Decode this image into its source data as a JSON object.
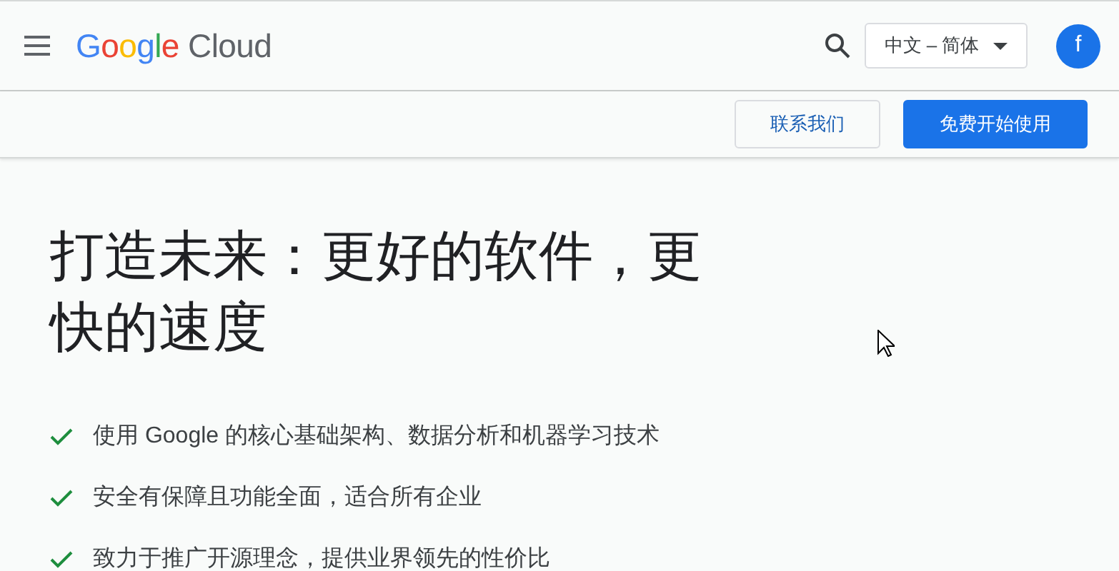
{
  "header": {
    "logo": "Google Cloud",
    "language": "中文 – 简体",
    "avatar": "f"
  },
  "actions": [
    {
      "label": "联系我们",
      "kind": "secondary"
    },
    {
      "label": "免费开始使用",
      "kind": "primary"
    }
  ],
  "hero": {
    "title": "打造未来：更好的软件，更快的速度",
    "features": [
      "使用 Google 的核心基础架构、数据分析和机器学习技术",
      "安全有保障且功能全面，适合所有企业",
      "致力于推广开源理念，提供业界领先的性价比"
    ]
  }
}
